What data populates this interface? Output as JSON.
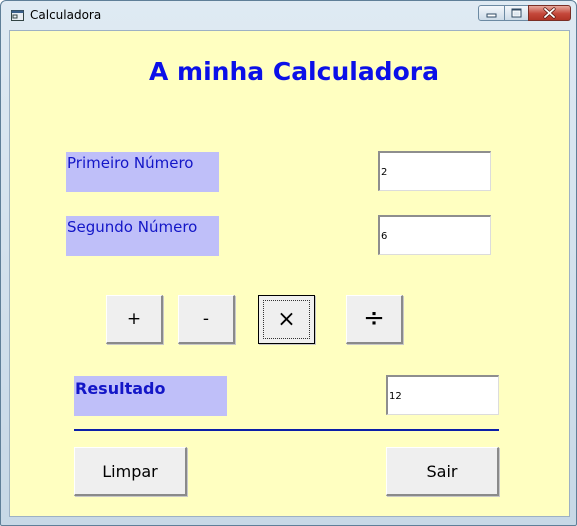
{
  "window": {
    "title": "Calculadora",
    "app_icon": "calculator-window-icon",
    "controls": {
      "minimize_icon": "minimize-icon",
      "maximize_icon": "maximize-icon",
      "close_icon": "close-icon"
    }
  },
  "form": {
    "title": "A minha Calculadora",
    "first_number": {
      "label": "Primeiro Número",
      "value": "2"
    },
    "second_number": {
      "label": "Segundo Número",
      "value": "6"
    },
    "operations": {
      "add": "+",
      "subtract": "-",
      "multiply": "×",
      "divide": "÷"
    },
    "result": {
      "label": "Resultado",
      "value": "12"
    },
    "buttons": {
      "clear": "Limpar",
      "exit": "Sair"
    }
  },
  "colors": {
    "form_background": "#ffffc1",
    "label_background": "#bfbff9",
    "title_text": "#0b10e8",
    "label_text": "#1316c7",
    "divider": "#0b1fa8"
  }
}
